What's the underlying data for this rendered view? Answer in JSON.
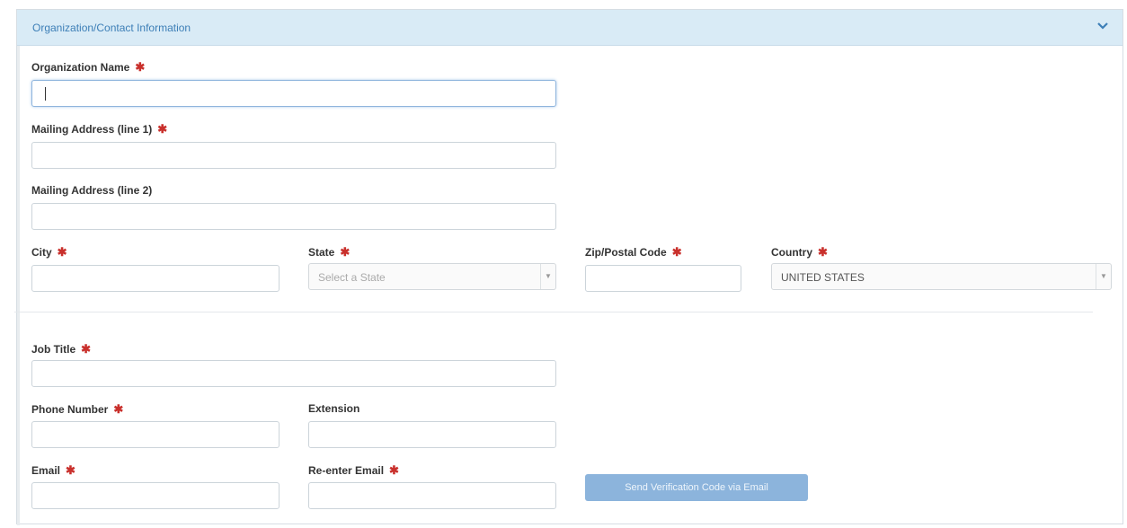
{
  "panel": {
    "title": "Organization/Contact Information"
  },
  "required_mark": "✱",
  "fields": {
    "org_name_label": "Organization Name",
    "addr1_label": "Mailing Address (line 1)",
    "addr2_label": "Mailing Address (line 2)",
    "city_label": "City",
    "state_label": "State",
    "state_placeholder": "Select a State",
    "zip_label": "Zip/Postal Code",
    "country_label": "Country",
    "country_value": "UNITED STATES",
    "job_title_label": "Job Title",
    "phone_label": "Phone Number",
    "extension_label": "Extension",
    "email_label": "Email",
    "reenter_email_label": "Re-enter Email"
  },
  "buttons": {
    "send_code": "Send Verification Code via Email"
  },
  "colors": {
    "accent": "#3d7fb7",
    "required": "#c9302c",
    "button_bg": "#8cb4dc"
  },
  "icons": {
    "collapse": "chevron-down-icon",
    "dropdown": "triangle-down-icon"
  }
}
